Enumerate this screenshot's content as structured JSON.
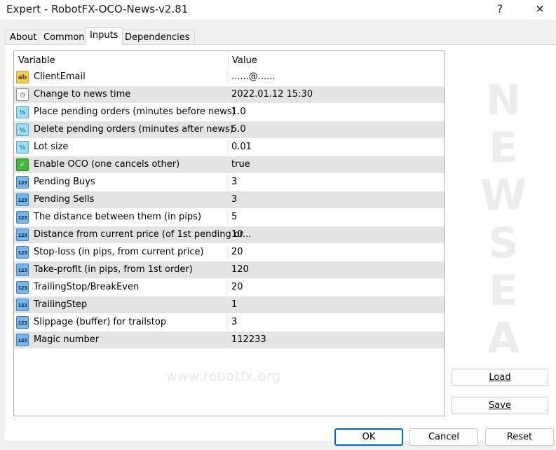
{
  "window": {
    "title": "Expert - RobotFX-OCO-News-v2.81",
    "help_glyph": "?",
    "close_glyph": "✕"
  },
  "tabs": [
    {
      "label": "About"
    },
    {
      "label": "Common"
    },
    {
      "label": "Inputs"
    },
    {
      "label": "Dependencies"
    }
  ],
  "active_tab": "Inputs",
  "table": {
    "col_variable": "Variable",
    "col_value": "Value",
    "rows": [
      {
        "icon": "string-icon",
        "icon_text": "ab",
        "name": "ClientEmail",
        "value": "......@......"
      },
      {
        "icon": "datetime-icon",
        "icon_text": "◷",
        "name": "Change to news time",
        "value": "2022.01.12 15:30"
      },
      {
        "icon": "double-icon",
        "icon_text": "½",
        "name": "Place pending orders (minutes before news)",
        "value": "1.0"
      },
      {
        "icon": "double-icon",
        "icon_text": "½",
        "name": "Delete pending orders (minutes after news)",
        "value": "5.0"
      },
      {
        "icon": "double-icon",
        "icon_text": "½",
        "name": "Lot size",
        "value": "0.01"
      },
      {
        "icon": "bool-icon",
        "icon_text": "✓",
        "name": "Enable OCO (one cancels other)",
        "value": "true"
      },
      {
        "icon": "integer-icon",
        "icon_text": "123",
        "name": "Pending Buys",
        "value": "3"
      },
      {
        "icon": "integer-icon",
        "icon_text": "123",
        "name": "Pending Sells",
        "value": "3"
      },
      {
        "icon": "integer-icon",
        "icon_text": "123",
        "name": "The distance between them (in pips)",
        "value": "5"
      },
      {
        "icon": "integer-icon",
        "icon_text": "123",
        "name": "Distance from current price (of 1st pending or...",
        "value": "10"
      },
      {
        "icon": "integer-icon",
        "icon_text": "123",
        "name": "Stop-loss (in pips, from current price)",
        "value": "20"
      },
      {
        "icon": "integer-icon",
        "icon_text": "123",
        "name": "Take-profit (in pips, from 1st order)",
        "value": "120"
      },
      {
        "icon": "integer-icon",
        "icon_text": "123",
        "name": "TrailingStop/BreakEven",
        "value": "20"
      },
      {
        "icon": "integer-icon",
        "icon_text": "123",
        "name": "TrailingStep",
        "value": "1"
      },
      {
        "icon": "integer-icon",
        "icon_text": "123",
        "name": "Slippage (buffer) for trailstop",
        "value": "3"
      },
      {
        "icon": "integer-icon",
        "icon_text": "123",
        "name": "Magic number",
        "value": "112233"
      }
    ]
  },
  "watermark": {
    "domain": "www.robotfx.org",
    "letters": [
      "N",
      "E",
      "W",
      "S",
      "E",
      "A"
    ]
  },
  "buttons": {
    "load": "Load",
    "save": "Save",
    "ok": "OK",
    "cancel": "Cancel",
    "reset": "Reset"
  },
  "colors": {
    "ok_border": "#0067c0",
    "stripe": "#e3e3e3"
  }
}
